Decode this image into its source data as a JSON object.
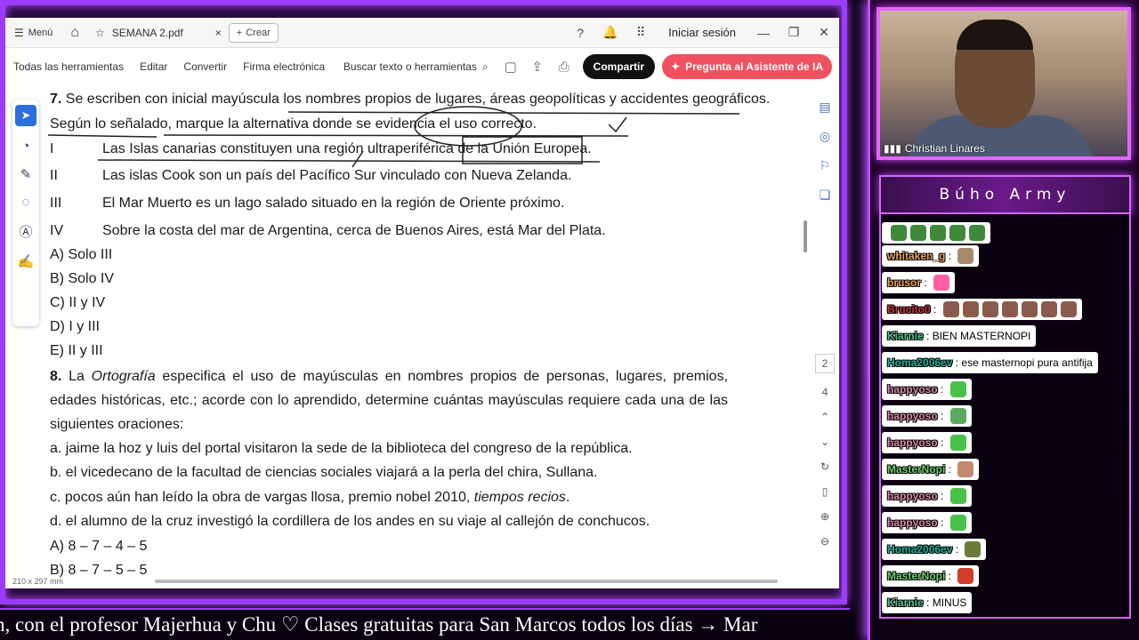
{
  "viewer": {
    "menu": "Menú",
    "tab_title": "SEMANA 2.pdf",
    "create": "Crear",
    "sign_in": "Iniciar sesión",
    "tools": [
      "Todas las herramientas",
      "Editar",
      "Convertir",
      "Firma electrónica"
    ],
    "search_placeholder": "Buscar texto o herramientas",
    "share": "Compartir",
    "ai_assistant": "Pregunta al Asistente de IA",
    "page_size": "210 x 297 mm",
    "page_nums": [
      "2",
      "4"
    ]
  },
  "document": {
    "q7_num": "7.",
    "q7_text": " Se escriben con inicial mayúscula los nombres propios de lugares, áreas geopolíticas y accidentes geográficos.",
    "q7_text2": "Según lo señalado, marque la alternativa donde se evidencia el uso correcto.",
    "q7_items": [
      {
        "num": "I",
        "text": "Las Islas canarias constituyen una región ultraperiférica de la Unión Europea."
      },
      {
        "num": "II",
        "text": "Las islas Cook son un país del Pacífico Sur vinculado con Nueva Zelanda."
      },
      {
        "num": "III",
        "text": "El Mar Muerto es un lago salado situado en la región de Oriente próximo."
      },
      {
        "num": "IV",
        "text": "Sobre la costa del mar de Argentina, cerca de Buenos Aires, está Mar del Plata."
      }
    ],
    "q7_options": [
      "A) Solo III",
      "B) Solo IV",
      "C) II y IV",
      "D) I y III",
      "E) II y III"
    ],
    "q8_num": "8.",
    "q8_pre": " La ",
    "q8_italic": "Ortografía",
    "q8_post": " especifica el uso de mayúsculas en nombres propios de personas, lugares, premios, edades históricas, etc.; acorde con lo aprendido, determine cuántas mayúsculas requiere cada una de las siguientes oraciones:",
    "q8_a": "a. jaime la hoz y luis del portal visitaron la sede de la biblioteca del congreso de la república.",
    "q8_b": "b. el vicedecano de la facultad de ciencias sociales viajará a la perla del chira, Sullana.",
    "q8_c_pre": "c. pocos aún han leído la obra de vargas llosa, premio nobel 2010, ",
    "q8_c_italic": "tiempos recios",
    "q8_c_post": ".",
    "q8_d": "d. el alumno de la cruz investigó la cordillera de los andes en su viaje al callejón de conchucos.",
    "q8_options": [
      "A) 8 – 7 – 4 – 5",
      "B) 8 – 7 – 5 – 5"
    ]
  },
  "stream": {
    "webcam_name": "Christian Linares",
    "chat_title": "Búho Army",
    "ticker": "n, con el profesor Majerhua y Chu  ♡     Clases gratuitas para San Marcos todos los días  →  Mar",
    "chat": [
      {
        "user": "",
        "text": "",
        "color": "#ffffff",
        "emotes": 5,
        "emote_color": "#3e8a3a"
      },
      {
        "user": "whitaken_g",
        "text": "",
        "color": "#e9a35a",
        "emotes": 1,
        "emote_color": "#a58a6d"
      },
      {
        "user": "brusor",
        "text": "",
        "color": "#e9a35a",
        "emotes": 1,
        "emote_color": "#ff5fa2"
      },
      {
        "user": "Brucito0",
        "text": "",
        "color": "#c8353a",
        "emotes": 7,
        "emote_color": "#8a5a4a"
      },
      {
        "user": "Kiarnie",
        "text": "BIEN MASTERNOPI",
        "color": "#4fc38a",
        "emotes": 0,
        "emote_color": ""
      },
      {
        "user": "Homa2006ev",
        "text": "ese masternopi pura antifija",
        "color": "#1fb39a",
        "emotes": 0,
        "emote_color": ""
      },
      {
        "user": "happyoso",
        "text": "",
        "color": "#d98aa5",
        "emotes": 1,
        "emote_color": "#4ac04a"
      },
      {
        "user": "happyoso",
        "text": "",
        "color": "#d98aa5",
        "emotes": 1,
        "emote_color": "#5fa85f"
      },
      {
        "user": "happyoso",
        "text": "",
        "color": "#d98aa5",
        "emotes": 1,
        "emote_color": "#4ac04a"
      },
      {
        "user": "MasterNopi",
        "text": "",
        "color": "#6fcf6f",
        "emotes": 1,
        "emote_color": "#c4896e"
      },
      {
        "user": "happyoso",
        "text": "",
        "color": "#d98aa5",
        "emotes": 1,
        "emote_color": "#4ac04a"
      },
      {
        "user": "happyoso",
        "text": "",
        "color": "#d98aa5",
        "emotes": 1,
        "emote_color": "#4ac04a"
      },
      {
        "user": "Homa2006ev",
        "text": "",
        "color": "#1fb39a",
        "emotes": 1,
        "emote_color": "#6b7a3a"
      },
      {
        "user": "MasterNopi",
        "text": "",
        "color": "#6fcf6f",
        "emotes": 1,
        "emote_color": "#d33a2a"
      },
      {
        "user": "Kiarnie",
        "text": "MINUS",
        "color": "#4fc38a",
        "emotes": 0,
        "emote_color": ""
      }
    ]
  },
  "colors": {
    "neon": "#9b3cff",
    "share_bg": "#111111",
    "ai_bg": "#f0515f",
    "selected_tool": "#2a6fdb"
  }
}
